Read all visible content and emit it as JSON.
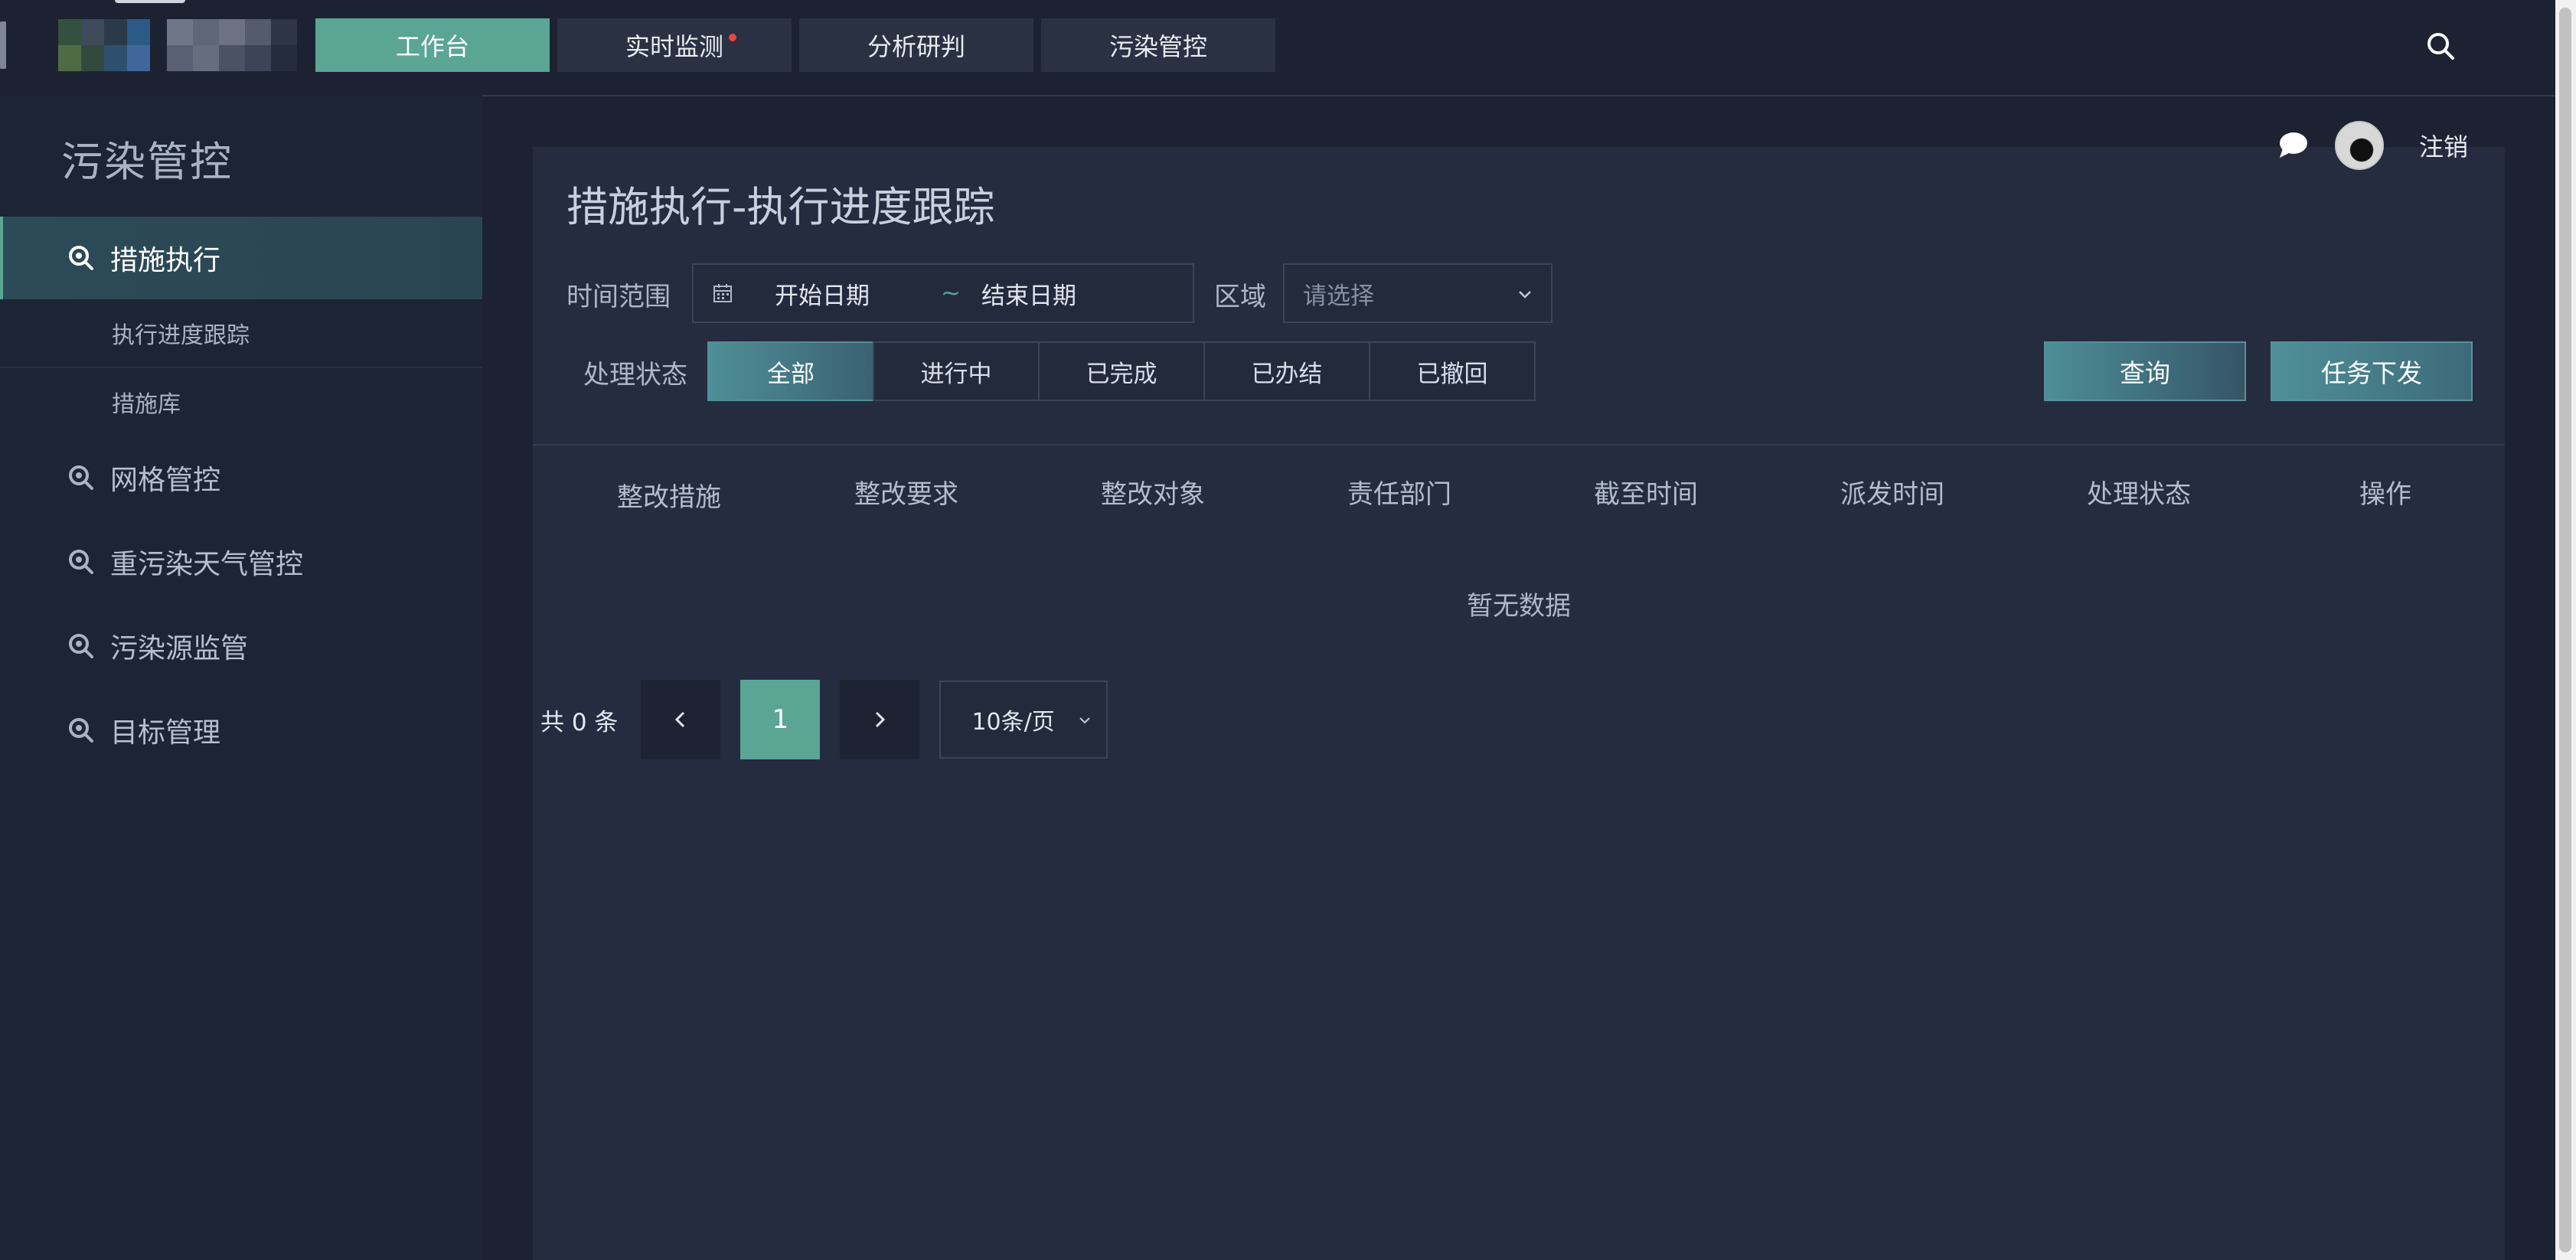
{
  "nav": {
    "tabs": [
      {
        "label": "工作台",
        "active": true
      },
      {
        "label": "实时监测",
        "active": false,
        "has_dot": true
      },
      {
        "label": "分析研判",
        "active": false
      },
      {
        "label": "污染管控",
        "active": false
      }
    ]
  },
  "sidebar": {
    "title": "污染管控",
    "items": [
      {
        "label": "措施执行",
        "icon": "search-target-icon",
        "active": true,
        "children": [
          {
            "label": "执行进度跟踪"
          },
          {
            "label": "措施库"
          }
        ]
      },
      {
        "label": "网格管控",
        "icon": "search-target-icon"
      },
      {
        "label": "重污染天气管控",
        "icon": "search-target-icon"
      },
      {
        "label": "污染源监管",
        "icon": "search-target-icon"
      },
      {
        "label": "目标管理",
        "icon": "search-target-icon"
      }
    ]
  },
  "user": {
    "logout_label": "注销"
  },
  "page": {
    "title": "措施执行-执行进度跟踪",
    "filters": {
      "time_range_label": "时间范围",
      "start_placeholder": "开始日期",
      "separator": "~",
      "end_placeholder": "结束日期",
      "region_label": "区域",
      "region_placeholder": "请选择",
      "status_label": "处理状态",
      "status_options": [
        "全部",
        "进行中",
        "已完成",
        "已办结",
        "已撤回"
      ],
      "status_selected": "全部"
    },
    "buttons": {
      "query": "查询",
      "dispatch": "任务下发"
    },
    "table": {
      "columns": [
        "整改措施",
        "整改要求",
        "整改对象",
        "责任部门",
        "截至时间",
        "派发时间",
        "处理状态",
        "操作"
      ],
      "rows": [],
      "empty_text": "暂无数据"
    },
    "pagination": {
      "total_text": "共 0 条",
      "current_page": "1",
      "page_size": "10条/页"
    }
  },
  "colors": {
    "accent": "#5aa594",
    "background": "#1c2232",
    "panel": "#252c40",
    "alert_dot": "#e8463c"
  }
}
